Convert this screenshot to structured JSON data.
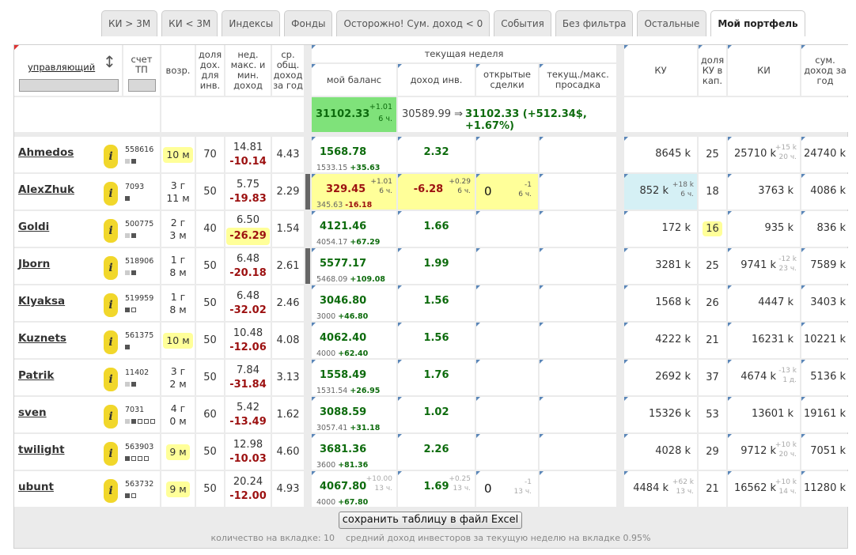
{
  "tabs": [
    "КИ > 3М",
    "КИ < 3М",
    "Индексы",
    "Фонды",
    "Осторожно! Сум. доход < 0",
    "События",
    "Без фильтра",
    "Остальные",
    "Мой портфель"
  ],
  "headers": {
    "manager": "управляющий",
    "account": "счет ТП",
    "age": "возр.",
    "share_income": "доля дох. для инв.",
    "week_maxmin": "нед. макс. и мин. доход",
    "avg_income": "ср. общ. доход за год",
    "current_week": "текущая неделя",
    "my_balance": "мой баланс",
    "inv_income": "доход инв.",
    "open_deals": "открытые сделки",
    "drawdown": "текущ./макс. просадка",
    "ku": "КУ",
    "ku_share": "доля КУ в кап.",
    "ki": "КИ",
    "sum_income": "сум. доход за год"
  },
  "summary": {
    "balance": "31102.33",
    "balance_delta": "+1.01",
    "balance_time": "6 ч.",
    "formula_from": "30589.99 ⇒",
    "formula_to": "31102.33 (+512.34$, +1.67%)"
  },
  "rows": [
    {
      "name": "Ahmedos",
      "account": "558616",
      "squares": "gf",
      "age1": "10 м",
      "age2": "",
      "age_hl": true,
      "share": "70",
      "wmax": "14.81",
      "wmin": "-10.14",
      "wmin_hl": false,
      "avg": "4.43",
      "marker": false,
      "bal": "1568.78",
      "bal_base": "1533.15",
      "bal_delta": "+35.63",
      "bal_hl": false,
      "bal_change": "",
      "bal_time": "",
      "inc": "2.32",
      "inc_hl": false,
      "inc_change": "",
      "inc_time": "",
      "open": "",
      "open_change": "",
      "open_time": "",
      "ku": "8645 k",
      "ku_hl": false,
      "ku_change": "",
      "ku_time": "",
      "kushare": "25",
      "kushare_hl": false,
      "ki": "25710 k",
      "ki_change": "+15 k",
      "ki_time": "20 ч.",
      "sum": "24740 k"
    },
    {
      "name": "AlexZhuk",
      "account": "7093",
      "squares": "f",
      "age1": "3 г",
      "age2": "11 м",
      "age_hl": false,
      "share": "50",
      "wmax": "5.75",
      "wmin": "-19.83",
      "wmin_hl": false,
      "avg": "2.29",
      "marker": true,
      "bal": "329.45",
      "bal_base": "345.63",
      "bal_delta": "-16.18",
      "bal_hl": true,
      "bal_change": "+1.01",
      "bal_time": "6 ч.",
      "inc": "-6.28",
      "inc_hl": true,
      "inc_change": "+0.29",
      "inc_time": "6 ч.",
      "open": "0",
      "open_change": "-1",
      "open_time": "6 ч.",
      "ku": "852 k",
      "ku_hl": true,
      "ku_change": "+18 k",
      "ku_time": "6 ч.",
      "kushare": "18",
      "kushare_hl": false,
      "ki": "3763 k",
      "ki_change": "",
      "ki_time": "",
      "sum": "4086 k"
    },
    {
      "name": "Goldi",
      "account": "500775",
      "squares": "gf",
      "age1": "2 г",
      "age2": "3 м",
      "age_hl": false,
      "share": "40",
      "wmax": "6.50",
      "wmin": "-26.29",
      "wmin_hl": true,
      "avg": "1.54",
      "marker": false,
      "bal": "4121.46",
      "bal_base": "4054.17",
      "bal_delta": "+67.29",
      "bal_hl": false,
      "bal_change": "",
      "bal_time": "",
      "inc": "1.66",
      "inc_hl": false,
      "inc_change": "",
      "inc_time": "",
      "open": "",
      "open_change": "",
      "open_time": "",
      "ku": "172 k",
      "ku_hl": false,
      "ku_change": "",
      "ku_time": "",
      "kushare": "16",
      "kushare_hl": true,
      "ki": "935 k",
      "ki_change": "",
      "ki_time": "",
      "sum": "836 k"
    },
    {
      "name": "Jborn",
      "account": "518906",
      "squares": "gf",
      "age1": "1 г",
      "age2": "8 м",
      "age_hl": false,
      "share": "50",
      "wmax": "6.48",
      "wmin": "-20.18",
      "wmin_hl": false,
      "avg": "2.61",
      "marker": true,
      "bal": "5577.17",
      "bal_base": "5468.09",
      "bal_delta": "+109.08",
      "bal_hl": false,
      "bal_change": "",
      "bal_time": "",
      "inc": "1.99",
      "inc_hl": false,
      "inc_change": "",
      "inc_time": "",
      "open": "",
      "open_change": "",
      "open_time": "",
      "ku": "3281 k",
      "ku_hl": false,
      "ku_change": "",
      "ku_time": "",
      "kushare": "25",
      "kushare_hl": false,
      "ki": "9741 k",
      "ki_change": "-12 k",
      "ki_time": "23 ч.",
      "sum": "7589 k"
    },
    {
      "name": "Klyaksa",
      "account": "519959",
      "squares": "fo",
      "age1": "1 г",
      "age2": "8 м",
      "age_hl": false,
      "share": "50",
      "wmax": "6.48",
      "wmin": "-32.02",
      "wmin_hl": false,
      "avg": "2.46",
      "marker": false,
      "bal": "3046.80",
      "bal_base": "3000",
      "bal_delta": "+46.80",
      "bal_hl": false,
      "bal_change": "",
      "bal_time": "",
      "inc": "1.56",
      "inc_hl": false,
      "inc_change": "",
      "inc_time": "",
      "open": "",
      "open_change": "",
      "open_time": "",
      "ku": "1568 k",
      "ku_hl": false,
      "ku_change": "",
      "ku_time": "",
      "kushare": "26",
      "kushare_hl": false,
      "ki": "4447 k",
      "ki_change": "",
      "ki_time": "",
      "sum": "3403 k"
    },
    {
      "name": "Kuznets",
      "account": "561375",
      "squares": "f",
      "age1": "10 м",
      "age2": "",
      "age_hl": true,
      "share": "50",
      "wmax": "10.48",
      "wmin": "-12.06",
      "wmin_hl": false,
      "avg": "4.08",
      "marker": false,
      "bal": "4062.40",
      "bal_base": "4000",
      "bal_delta": "+62.40",
      "bal_hl": false,
      "bal_change": "",
      "bal_time": "",
      "inc": "1.56",
      "inc_hl": false,
      "inc_change": "",
      "inc_time": "",
      "open": "",
      "open_change": "",
      "open_time": "",
      "ku": "4222 k",
      "ku_hl": false,
      "ku_change": "",
      "ku_time": "",
      "kushare": "21",
      "kushare_hl": false,
      "ki": "16231 k",
      "ki_change": "",
      "ki_time": "",
      "sum": "10221 k"
    },
    {
      "name": "Patrik",
      "account": "11402",
      "squares": "gf",
      "age1": "3 г",
      "age2": "2 м",
      "age_hl": false,
      "share": "50",
      "wmax": "7.84",
      "wmin": "-31.84",
      "wmin_hl": false,
      "avg": "3.13",
      "marker": false,
      "bal": "1558.49",
      "bal_base": "1531.54",
      "bal_delta": "+26.95",
      "bal_hl": false,
      "bal_change": "",
      "bal_time": "",
      "inc": "1.76",
      "inc_hl": false,
      "inc_change": "",
      "inc_time": "",
      "open": "",
      "open_change": "",
      "open_time": "",
      "ku": "2692 k",
      "ku_hl": false,
      "ku_change": "",
      "ku_time": "",
      "kushare": "37",
      "kushare_hl": false,
      "ki": "4674 k",
      "ki_change": "-13 k",
      "ki_time": "1 д.",
      "sum": "5136 k"
    },
    {
      "name": "sven",
      "account": "7031",
      "squares": "gfooo",
      "age1": "4 г",
      "age2": "0 м",
      "age_hl": false,
      "share": "60",
      "wmax": "5.42",
      "wmin": "-13.49",
      "wmin_hl": false,
      "avg": "1.62",
      "marker": false,
      "bal": "3088.59",
      "bal_base": "3057.41",
      "bal_delta": "+31.18",
      "bal_hl": false,
      "bal_change": "",
      "bal_time": "",
      "inc": "1.02",
      "inc_hl": false,
      "inc_change": "",
      "inc_time": "",
      "open": "",
      "open_change": "",
      "open_time": "",
      "ku": "15326 k",
      "ku_hl": false,
      "ku_change": "",
      "ku_time": "",
      "kushare": "53",
      "kushare_hl": false,
      "ki": "13601 k",
      "ki_change": "",
      "ki_time": "",
      "sum": "19161 k"
    },
    {
      "name": "twilight",
      "account": "563903",
      "squares": "fooo",
      "age1": "9 м",
      "age2": "",
      "age_hl": true,
      "share": "50",
      "wmax": "12.98",
      "wmin": "-10.03",
      "wmin_hl": false,
      "avg": "4.60",
      "marker": false,
      "bal": "3681.36",
      "bal_base": "3600",
      "bal_delta": "+81.36",
      "bal_hl": false,
      "bal_change": "",
      "bal_time": "",
      "inc": "2.26",
      "inc_hl": false,
      "inc_change": "",
      "inc_time": "",
      "open": "",
      "open_change": "",
      "open_time": "",
      "ku": "4028 k",
      "ku_hl": false,
      "ku_change": "",
      "ku_time": "",
      "kushare": "29",
      "kushare_hl": false,
      "ki": "9712 k",
      "ki_change": "+10 k",
      "ki_time": "20 ч.",
      "sum": "7051 k"
    },
    {
      "name": "ubunt",
      "account": "563732",
      "squares": "fo",
      "age1": "9 м",
      "age2": "",
      "age_hl": true,
      "share": "50",
      "wmax": "20.24",
      "wmin": "-12.00",
      "wmin_hl": false,
      "avg": "4.93",
      "marker": false,
      "bal": "4067.80",
      "bal_base": "4000",
      "bal_delta": "+67.80",
      "bal_hl": false,
      "bal_change": "+10.00",
      "bal_time": "13 ч.",
      "inc": "1.69",
      "inc_hl": false,
      "inc_change": "+0.25",
      "inc_time": "13 ч.",
      "open": "0",
      "open_change": "-1",
      "open_time": "13 ч.",
      "ku": "4484 k",
      "ku_hl": false,
      "ku_change": "+62 k",
      "ku_time": "13 ч.",
      "kushare": "21",
      "kushare_hl": false,
      "ki": "16562 k",
      "ki_change": "+10 k",
      "ki_time": "14 ч.",
      "sum": "11280 k"
    }
  ],
  "save_button": "сохранить таблицу в файл Excel",
  "footer": "количество на вкладке: 10    средний доход инвесторов за текущую неделю на вкладке 0.95%",
  "colors": {
    "positive": "#0d6b0d",
    "negative": "#9c1010",
    "highlight": "#ffff99",
    "balance_bg": "#7fe27a",
    "ku_highlight": "#d5f0f5",
    "info_badge": "#f1d72b"
  }
}
